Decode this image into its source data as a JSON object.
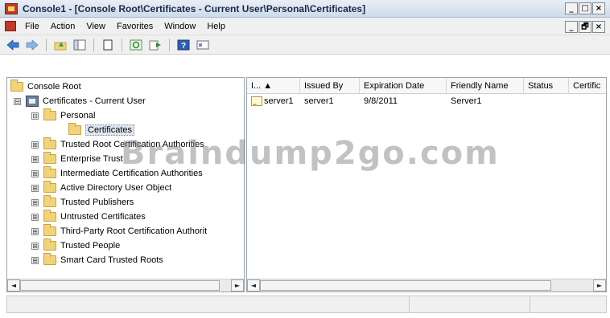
{
  "window": {
    "title": "Console1 - [Console Root\\Certificates - Current User\\Personal\\Certificates]",
    "title_buttons": [
      "_",
      "□",
      "×"
    ],
    "mdi_buttons": [
      "_",
      "🗗",
      "×"
    ]
  },
  "menubar": {
    "items": [
      "File",
      "Action",
      "View",
      "Favorites",
      "Window",
      "Help"
    ]
  },
  "toolbar": {
    "buttons": [
      "back-arrow-icon",
      "forward-arrow-icon",
      "up-folder-icon",
      "show-hide-tree-icon",
      "new-window-icon",
      "refresh-icon",
      "export-list-icon",
      "help-icon",
      "properties-icon"
    ]
  },
  "tree": {
    "items": [
      {
        "label": "Console Root"
      },
      {
        "label": "Certificates - Current User",
        "expander": "⊟"
      },
      {
        "label": "Personal",
        "expander": "⊟"
      },
      {
        "label": "Certificates",
        "selected": true
      },
      {
        "label": "Trusted Root Certification Authorities",
        "expander": "⊞"
      },
      {
        "label": "Enterprise Trust",
        "expander": "⊞"
      },
      {
        "label": "Intermediate Certification Authorities",
        "expander": "⊞"
      },
      {
        "label": "Active Directory User Object",
        "expander": "⊞"
      },
      {
        "label": "Trusted Publishers",
        "expander": "⊞"
      },
      {
        "label": "Untrusted Certificates",
        "expander": "⊞"
      },
      {
        "label": "Third-Party Root Certification Authorit",
        "expander": "⊞"
      },
      {
        "label": "Trusted People",
        "expander": "⊞"
      },
      {
        "label": "Smart Card Trusted Roots",
        "expander": "⊞"
      }
    ]
  },
  "list": {
    "columns": [
      "I...  ▲",
      "Issued By",
      "Expiration Date",
      "Friendly Name",
      "Status",
      "Certific"
    ],
    "rows": [
      {
        "issued_to": "server1",
        "issued_by": "server1",
        "expiration": "9/8/2011",
        "friendly_name": "Server1",
        "status": "",
        "template": ""
      }
    ]
  },
  "scroll": {
    "left_arrow": "◄",
    "right_arrow": "►"
  },
  "watermark": "Braindump2go.com"
}
